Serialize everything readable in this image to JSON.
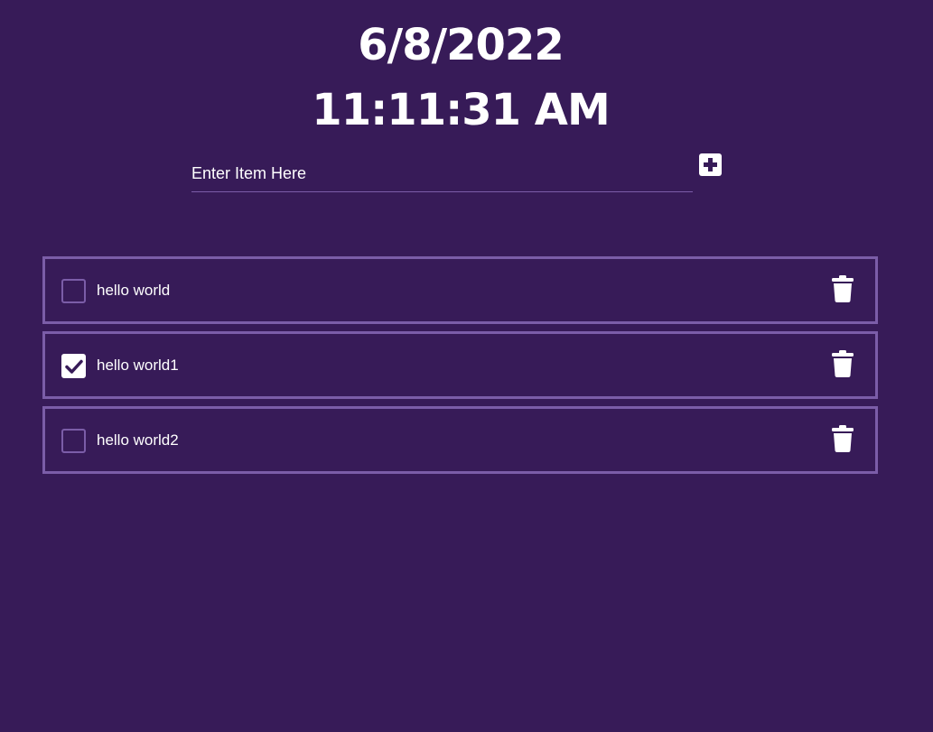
{
  "clock": {
    "date": "6/8/2022",
    "time": "11:11:31 AM"
  },
  "new_item": {
    "placeholder": "Enter Item Here",
    "value": "",
    "add_icon": "plus-square-icon"
  },
  "todos": [
    {
      "text": "hello world",
      "checked": false
    },
    {
      "text": "hello world1",
      "checked": true
    },
    {
      "text": "hello world2",
      "checked": false
    }
  ],
  "icons": {
    "checkbox_checked": "check-icon",
    "delete": "trash-icon"
  },
  "colors": {
    "background": "#371b58",
    "border": "#7b5da8",
    "text": "#ffffff"
  }
}
